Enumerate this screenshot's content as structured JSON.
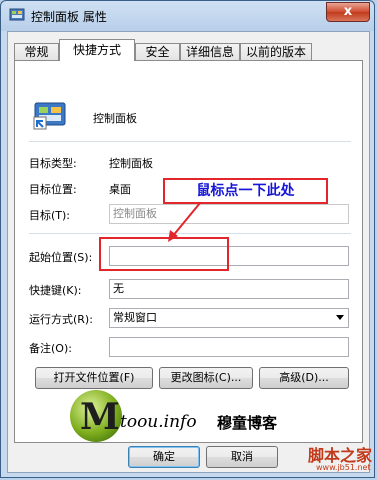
{
  "window": {
    "title": "控制面板 属性",
    "close_label": "x"
  },
  "tabs": [
    {
      "label": "常规",
      "active": false
    },
    {
      "label": "快捷方式",
      "active": true
    },
    {
      "label": "安全",
      "active": false
    },
    {
      "label": "详细信息",
      "active": false
    },
    {
      "label": "以前的版本",
      "active": false
    }
  ],
  "shortcut": {
    "name": "控制面板",
    "icon": "control-panel-icon",
    "target_type_label": "目标类型:",
    "target_type_value": "控制面板",
    "target_location_label": "目标位置:",
    "target_location_value": "桌面",
    "target_label": "目标(T):",
    "target_value": "控制面板",
    "start_in_label": "起始位置(S):",
    "start_in_value": "",
    "hotkey_label": "快捷键(K):",
    "hotkey_value": "无",
    "run_label": "运行方式(R):",
    "run_value": "常规窗口",
    "comment_label": "备注(O):",
    "comment_value": "",
    "open_location_button": "打开文件位置(F)",
    "change_icon_button": "更改图标(C)...",
    "advanced_button": "高级(D)..."
  },
  "annotation": {
    "callout_text": "鼠标点一下此处",
    "highlight_color": "#e2262b",
    "text_color": "#1616d6"
  },
  "buttons": {
    "ok": "确定",
    "cancel": "取消"
  },
  "watermark": {
    "logo_letter": "M",
    "logo_text": "toou.info",
    "logo_cn": "穆童博客",
    "site_cn": "脚本之家",
    "site_url": "www.jb51.net"
  }
}
